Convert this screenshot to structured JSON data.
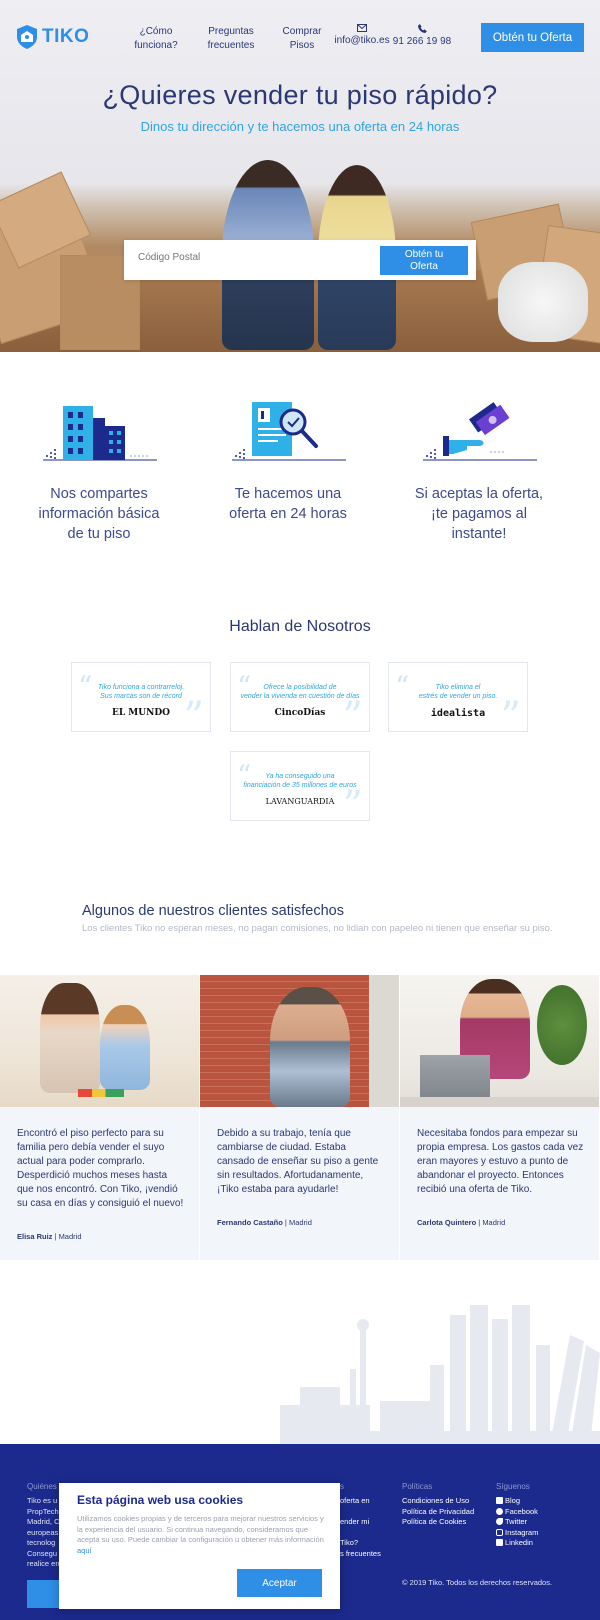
{
  "header": {
    "logo_text": "TIKO",
    "nav": [
      {
        "label_line1": "¿Cómo",
        "label_line2": "funciona?"
      },
      {
        "label_line1": "Preguntas",
        "label_line2": "frecuentes"
      },
      {
        "label_line1": "Comprar",
        "label_line2": "Pisos"
      }
    ],
    "email": "info@tiko.es",
    "phone": "91 266 19 98",
    "cta_label": "Obtén tu Oferta",
    "brand_color": "#2f8ee6"
  },
  "hero": {
    "title": "¿Quieres vender tu piso rápido?",
    "subtitle": "Dinos tu dirección y te hacemos una oferta en 24 horas",
    "search_placeholder": "Código Postal",
    "search_button_line1": "Obtén tu",
    "search_button_line2": "Oferta"
  },
  "steps": [
    {
      "icon": "buildings-icon",
      "line1": "Nos compartes",
      "line2": "información básica",
      "line3": "de tu piso"
    },
    {
      "icon": "document-magnifier-icon",
      "line1": "Te hacemos una",
      "line2": "oferta en 24 horas",
      "line3": ""
    },
    {
      "icon": "hand-money-icon",
      "line1": "Si aceptas la oferta,",
      "line2": "¡te pagamos al",
      "line3": "instante!"
    }
  ],
  "press": {
    "title": "Hablan de Nosotros",
    "items": [
      {
        "quote_line1": "Tiko funciona a contrarreloj.",
        "quote_line2": "Sus marcas son de récord",
        "source": "EL MUNDO"
      },
      {
        "quote_line1": "Ofrece la posibilidad de",
        "quote_line2": "vender la vivienda en cuestión de días",
        "source": "CincoDías"
      },
      {
        "quote_line1": "Tiko elimina el",
        "quote_line2": "estrés de vender un piso.",
        "source": "idealista"
      },
      {
        "quote_line1": "Ya ha conseguido una",
        "quote_line2": "financiación de 35 millones de euros",
        "source": "LAVANGUARDIA"
      }
    ]
  },
  "clients": {
    "title": "Algunos de nuestros clientes satisfechos",
    "subtitle": "Los clientes Tiko no esperan meses, no pagan comisiones, no lidian con papeleo ni tienen que enseñar su piso.",
    "testimonials": [
      {
        "text": "Encontró el piso perfecto para su familia pero debía vender el suyo actual para poder comprarlo. Desperdició muchos meses hasta que nos encontró. Con Tiko, ¡vendió su casa en días y consiguió el nuevo!",
        "name": "Elisa Ruiz",
        "city": "Madrid"
      },
      {
        "text": "Debido a su trabajo, tenía que cambiarse de ciudad. Estaba cansado de enseñar su piso a gente sin resultados. Afortudanamente, ¡Tiko estaba para ayudarle!",
        "name": "Fernando Castaño",
        "city": "Madrid"
      },
      {
        "text": "Necesitaba fondos para empezar su propia empresa. Los gastos cada vez eran mayores y estuvo a punto de abandonar el proyecto. Entonces recibió una oferta de Tiko.",
        "name": "Carlota Quintero",
        "city": "Madrid"
      }
    ]
  },
  "footer": {
    "col1_title": "Quiénes",
    "col1_text": [
      "Tiko es u",
      "PropTech",
      "Madrid, C",
      "europeas",
      "tecnolog",
      "Consegu",
      "realice en"
    ],
    "col3_title": "s",
    "col3_links": [
      "oferta en",
      "ender mi",
      "",
      "Tiko?",
      "s frecuentes"
    ],
    "col4_title": "Políticas",
    "col4_links": [
      "Condiciones de Uso",
      "Política de Privacidad",
      "Política de Cookies"
    ],
    "col5_title": "Síguenos",
    "col5_links": [
      "Blog",
      "Facebook",
      "Twitter",
      "Instagram",
      "Linkedin"
    ],
    "copyright": "© 2019 Tiko. Todos los derechos reservados."
  },
  "cookies": {
    "title": "Esta página web usa cookies",
    "text": "Utilizamos cookies propias y de terceros para mejorar nuestros servicios y la experiencia del usuario. Si continua navegando, consideramos que acepta su uso. Puede cambiar la configuración u obtener más información",
    "link": "aquí",
    "accept_label": "Aceptar"
  }
}
